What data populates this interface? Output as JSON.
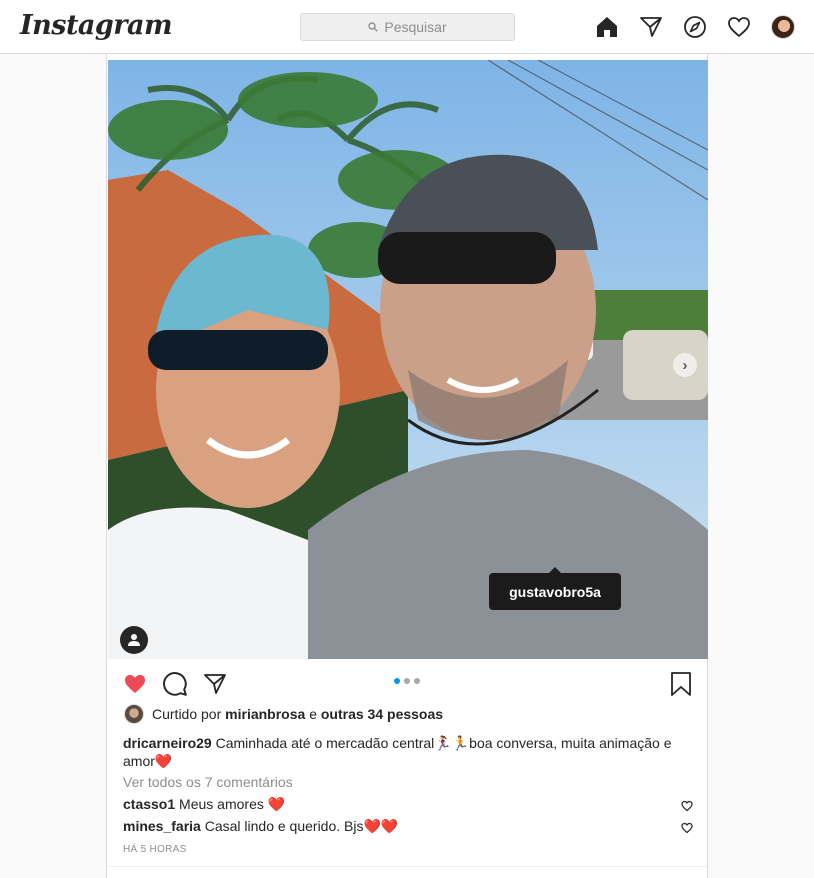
{
  "app": {
    "logo": "Instagram"
  },
  "search": {
    "placeholder": "Pesquisar"
  },
  "nav": {
    "icons": [
      "home-icon",
      "direct-icon",
      "explore-icon",
      "activity-heart-icon",
      "profile-avatar"
    ]
  },
  "post": {
    "photo_tag": "gustavobro5a",
    "carousel": {
      "count": 3,
      "active": 1
    },
    "likes": {
      "prefix": "Curtido por",
      "user": "mirianbrosa",
      "conj": "e",
      "others": "outras 34 pessoas"
    },
    "caption": {
      "user": "dricarneiro29",
      "text": "Caminhada até o mercadão central🏃‍♀️🏃boa conversa, muita animação e amor❤️"
    },
    "view_all": "Ver todos os 7 comentários",
    "comments": [
      {
        "user": "ctasso1",
        "text": "Meus amores ❤️"
      },
      {
        "user": "mines_faria",
        "text": "Casal lindo e querido. Bjs❤️❤️"
      }
    ],
    "time": "HÁ 5 HORAS",
    "colors": {
      "like_red": "#ed4956",
      "accent_blue": "#0095f6"
    }
  }
}
